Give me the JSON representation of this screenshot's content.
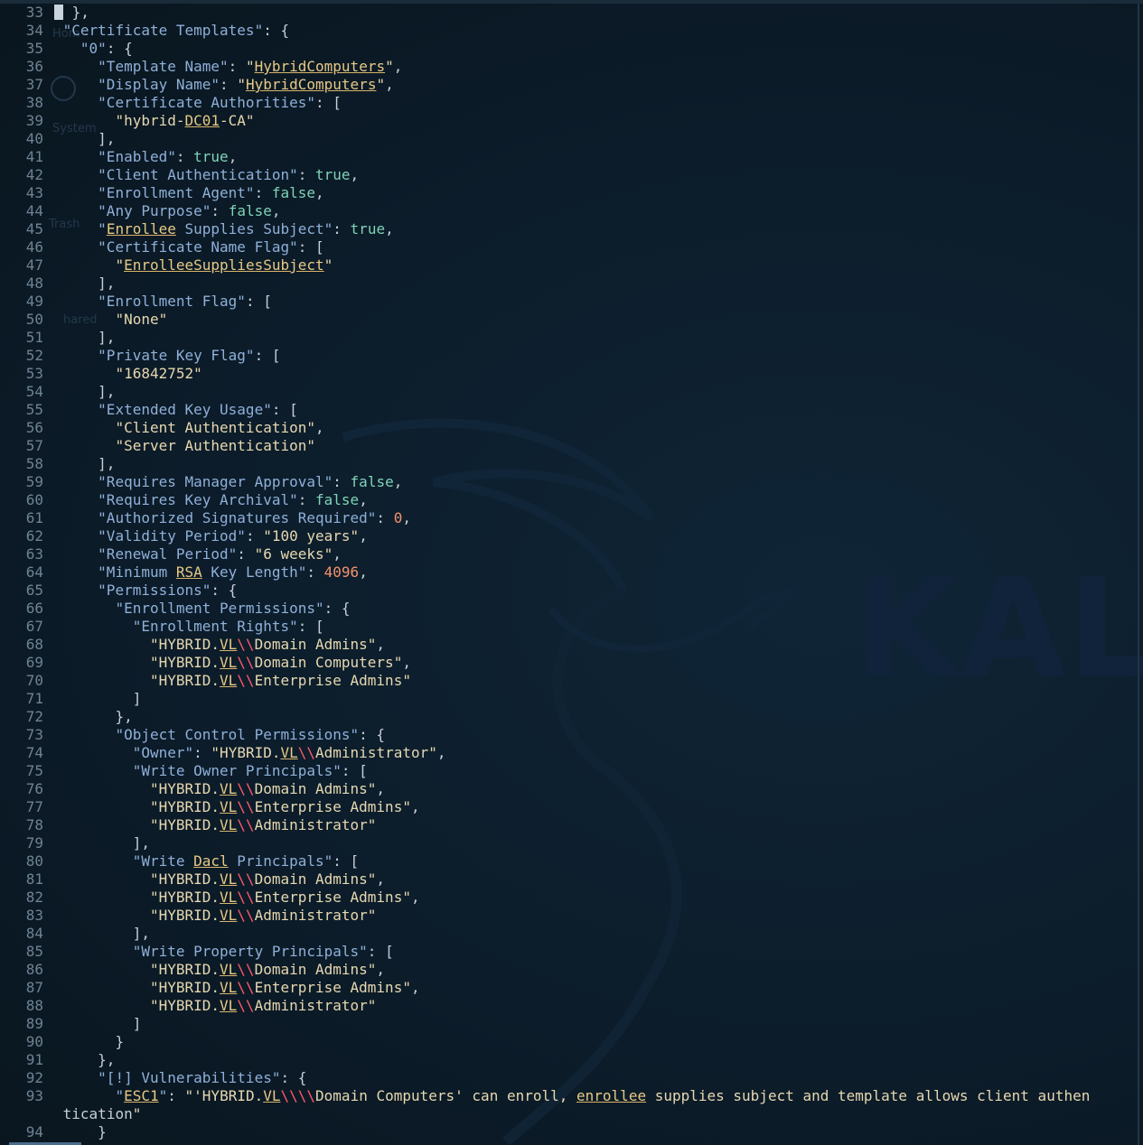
{
  "editor": {
    "lines": [
      {
        "n": "33",
        "t": "},"
      },
      {
        "n": "34",
        "t": "\"Certificate Templates\": {"
      },
      {
        "n": "35",
        "t": "  \"0\": {"
      },
      {
        "n": "36",
        "t": "    \"Template Name\": \"HybridComputers\","
      },
      {
        "n": "37",
        "t": "    \"Display Name\": \"HybridComputers\","
      },
      {
        "n": "38",
        "t": "    \"Certificate Authorities\": ["
      },
      {
        "n": "39",
        "t": "      \"hybrid-DC01-CA\""
      },
      {
        "n": "40",
        "t": "    ],"
      },
      {
        "n": "41",
        "t": "    \"Enabled\": true,"
      },
      {
        "n": "42",
        "t": "    \"Client Authentication\": true,"
      },
      {
        "n": "43",
        "t": "    \"Enrollment Agent\": false,"
      },
      {
        "n": "44",
        "t": "    \"Any Purpose\": false,"
      },
      {
        "n": "45",
        "t": "    \"Enrollee Supplies Subject\": true,"
      },
      {
        "n": "46",
        "t": "    \"Certificate Name Flag\": ["
      },
      {
        "n": "47",
        "t": "      \"EnrolleeSuppliesSubject\""
      },
      {
        "n": "48",
        "t": "    ],"
      },
      {
        "n": "49",
        "t": "    \"Enrollment Flag\": ["
      },
      {
        "n": "50",
        "t": "      \"None\""
      },
      {
        "n": "51",
        "t": "    ],"
      },
      {
        "n": "52",
        "t": "    \"Private Key Flag\": ["
      },
      {
        "n": "53",
        "t": "      \"16842752\""
      },
      {
        "n": "54",
        "t": "    ],"
      },
      {
        "n": "55",
        "t": "    \"Extended Key Usage\": ["
      },
      {
        "n": "56",
        "t": "      \"Client Authentication\","
      },
      {
        "n": "57",
        "t": "      \"Server Authentication\""
      },
      {
        "n": "58",
        "t": "    ],"
      },
      {
        "n": "59",
        "t": "    \"Requires Manager Approval\": false,"
      },
      {
        "n": "60",
        "t": "    \"Requires Key Archival\": false,"
      },
      {
        "n": "61",
        "t": "    \"Authorized Signatures Required\": 0,"
      },
      {
        "n": "62",
        "t": "    \"Validity Period\": \"100 years\","
      },
      {
        "n": "63",
        "t": "    \"Renewal Period\": \"6 weeks\","
      },
      {
        "n": "64",
        "t": "    \"Minimum RSA Key Length\": 4096,"
      },
      {
        "n": "65",
        "t": "    \"Permissions\": {"
      },
      {
        "n": "66",
        "t": "      \"Enrollment Permissions\": {"
      },
      {
        "n": "67",
        "t": "        \"Enrollment Rights\": ["
      },
      {
        "n": "68",
        "t": "          \"HYBRID.VL\\\\Domain Admins\","
      },
      {
        "n": "69",
        "t": "          \"HYBRID.VL\\\\Domain Computers\","
      },
      {
        "n": "70",
        "t": "          \"HYBRID.VL\\\\Enterprise Admins\""
      },
      {
        "n": "71",
        "t": "        ]"
      },
      {
        "n": "72",
        "t": "      },"
      },
      {
        "n": "73",
        "t": "      \"Object Control Permissions\": {"
      },
      {
        "n": "74",
        "t": "        \"Owner\": \"HYBRID.VL\\\\Administrator\","
      },
      {
        "n": "75",
        "t": "        \"Write Owner Principals\": ["
      },
      {
        "n": "76",
        "t": "          \"HYBRID.VL\\\\Domain Admins\","
      },
      {
        "n": "77",
        "t": "          \"HYBRID.VL\\\\Enterprise Admins\","
      },
      {
        "n": "78",
        "t": "          \"HYBRID.VL\\\\Administrator\""
      },
      {
        "n": "79",
        "t": "        ],"
      },
      {
        "n": "80",
        "t": "        \"Write Dacl Principals\": ["
      },
      {
        "n": "81",
        "t": "          \"HYBRID.VL\\\\Domain Admins\","
      },
      {
        "n": "82",
        "t": "          \"HYBRID.VL\\\\Enterprise Admins\","
      },
      {
        "n": "83",
        "t": "          \"HYBRID.VL\\\\Administrator\""
      },
      {
        "n": "84",
        "t": "        ],"
      },
      {
        "n": "85",
        "t": "        \"Write Property Principals\": ["
      },
      {
        "n": "86",
        "t": "          \"HYBRID.VL\\\\Domain Admins\","
      },
      {
        "n": "87",
        "t": "          \"HYBRID.VL\\\\Enterprise Admins\","
      },
      {
        "n": "88",
        "t": "          \"HYBRID.VL\\\\Administrator\""
      },
      {
        "n": "89",
        "t": "        ]"
      },
      {
        "n": "90",
        "t": "      }"
      },
      {
        "n": "91",
        "t": "    },"
      },
      {
        "n": "92",
        "t": "    \"[!] Vulnerabilities\": {"
      },
      {
        "n": "93",
        "t": "      \"ESC1\": \"'HYBRID.VL\\\\\\\\Domain Computers' can enroll, enrollee supplies subject and template allows client authen"
      },
      {
        "n": "",
        "t": "tication\""
      },
      {
        "n": "94",
        "t": "    }"
      }
    ]
  },
  "underlined_words": [
    "HybridComputers",
    "DC01",
    "Enrollee",
    "EnrolleeSuppliesSubject",
    "RSA",
    "VL",
    "Dacl",
    "ESC1",
    "enrollee"
  ],
  "desktop_background": {
    "watermark": "KALI",
    "ghost_labels": [
      "Hom",
      "System",
      "Trash",
      "hared"
    ]
  },
  "colors": {
    "background": "#0b1a26",
    "key": "#8fb0d8",
    "string": "#e6d8b0",
    "boolean": "#7fd3b6",
    "number": "#f3926b",
    "escape": "#ff5a6c",
    "line_number": "#6e8393"
  }
}
